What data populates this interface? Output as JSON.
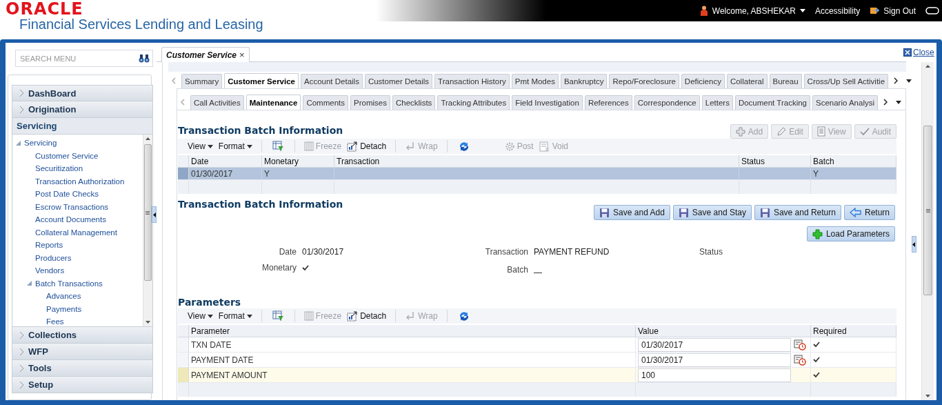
{
  "header": {
    "logo": "ORACLE",
    "product": "Financial Services Lending and Leasing",
    "user_menu": "Welcome, ABSHEKAR",
    "accessibility": "Accessibility",
    "sign_out": "Sign Out"
  },
  "sidebar": {
    "search": {
      "placeholder": "SEARCH MENU"
    },
    "sections": [
      {
        "label": "DashBoard",
        "expanded": false
      },
      {
        "label": "Origination",
        "expanded": false
      },
      {
        "label": "Servicing",
        "expanded": true,
        "tree": [
          {
            "label": "Servicing",
            "expanded": true,
            "children": [
              {
                "label": "Customer Service"
              },
              {
                "label": "Securitization"
              },
              {
                "label": "Transaction Authorization"
              },
              {
                "label": "Post Date Checks"
              },
              {
                "label": "Escrow Transactions"
              },
              {
                "label": "Account Documents"
              },
              {
                "label": "Collateral Management"
              },
              {
                "label": "Reports"
              },
              {
                "label": "Producers"
              },
              {
                "label": "Vendors"
              },
              {
                "label": "Batch Transactions",
                "expanded": true,
                "children": [
                  {
                    "label": "Advances"
                  },
                  {
                    "label": "Payments"
                  },
                  {
                    "label": "Fees"
                  }
                ]
              }
            ]
          }
        ]
      },
      {
        "label": "Collections",
        "expanded": false
      },
      {
        "label": "WFP",
        "expanded": false
      },
      {
        "label": "Tools",
        "expanded": false
      },
      {
        "label": "Setup",
        "expanded": false
      }
    ]
  },
  "document_tab": {
    "label": "Customer Service",
    "close": "×"
  },
  "close_link": "Close",
  "tabs": [
    {
      "label": "Summary",
      "selected": false
    },
    {
      "label": "Customer Service",
      "selected": true
    },
    {
      "label": "Account Details",
      "selected": false
    },
    {
      "label": "Customer Details",
      "selected": false
    },
    {
      "label": "Transaction History",
      "selected": false
    },
    {
      "label": "Pmt Modes",
      "selected": false
    },
    {
      "label": "Bankruptcy",
      "selected": false
    },
    {
      "label": "Repo/Foreclosure",
      "selected": false
    },
    {
      "label": "Deficiency",
      "selected": false
    },
    {
      "label": "Collateral",
      "selected": false
    },
    {
      "label": "Bureau",
      "selected": false
    },
    {
      "label": "Cross/Up Sell Activitie",
      "selected": false
    }
  ],
  "subtabs": [
    {
      "label": "Call Activities",
      "selected": false
    },
    {
      "label": "Maintenance",
      "selected": true
    },
    {
      "label": "Comments",
      "selected": false
    },
    {
      "label": "Promises",
      "selected": false
    },
    {
      "label": "Checklists",
      "selected": false
    },
    {
      "label": "Tracking Attributes",
      "selected": false
    },
    {
      "label": "Field Investigation",
      "selected": false
    },
    {
      "label": "References",
      "selected": false
    },
    {
      "label": "Correspondence",
      "selected": false
    },
    {
      "label": "Letters",
      "selected": false
    },
    {
      "label": "Document Tracking",
      "selected": false
    },
    {
      "label": "Scenario Analysi",
      "selected": false
    }
  ],
  "batch_list": {
    "title": "Transaction Batch Information",
    "actions": [
      {
        "kind": "add",
        "label": "Add",
        "disabled": true
      },
      {
        "kind": "edit",
        "label": "Edit",
        "disabled": true
      },
      {
        "kind": "view",
        "label": "View",
        "disabled": true
      },
      {
        "kind": "audit",
        "label": "Audit",
        "disabled": true
      }
    ],
    "toolbar": [
      {
        "kind": "menu",
        "label": "View",
        "disabled": false
      },
      {
        "kind": "menu",
        "label": "Format",
        "disabled": false
      },
      {
        "kind": "filter"
      },
      {
        "kind": "freeze",
        "label": "Freeze",
        "disabled": true
      },
      {
        "kind": "detach",
        "label": "Detach",
        "disabled": false
      },
      {
        "kind": "wrap",
        "label": "Wrap",
        "disabled": true
      },
      {
        "kind": "refresh"
      },
      {
        "kind": "post",
        "label": "Post",
        "disabled": true
      },
      {
        "kind": "void",
        "label": "Void",
        "disabled": true
      }
    ],
    "columns": [
      "Date",
      "Monetary",
      "Transaction",
      "Status",
      "Batch"
    ],
    "rows": [
      {
        "selected": true,
        "cells": [
          "01/30/2017",
          "Y",
          "",
          "",
          "Y"
        ]
      }
    ]
  },
  "batch_detail": {
    "title": "Transaction Batch Information",
    "buttons": [
      {
        "kind": "save",
        "label": "Save and Add"
      },
      {
        "kind": "save",
        "label": "Save and Stay"
      },
      {
        "kind": "save",
        "label": "Save and Return"
      },
      {
        "kind": "back",
        "label": "Return"
      }
    ],
    "load_button": "Load Parameters",
    "date_label": "Date",
    "date": "01/30/2017",
    "monetary_label": "Monetary",
    "monetary": true,
    "transaction_label": "Transaction",
    "transaction": "PAYMENT REFUND",
    "batch_label": "Batch",
    "status_label": "Status"
  },
  "parameters": {
    "title": "Parameters",
    "toolbar": [
      {
        "kind": "menu",
        "label": "View",
        "disabled": false
      },
      {
        "kind": "menu",
        "label": "Format",
        "disabled": false
      },
      {
        "kind": "filter"
      },
      {
        "kind": "freeze",
        "label": "Freeze",
        "disabled": true
      },
      {
        "kind": "detach",
        "label": "Detach",
        "disabled": false
      },
      {
        "kind": "wrap",
        "label": "Wrap",
        "disabled": true
      },
      {
        "kind": "refresh"
      }
    ],
    "columns": [
      "Parameter",
      "Value",
      "Required"
    ],
    "rows": [
      {
        "name": "TXN DATE",
        "value": "01/30/2017",
        "kind": "date",
        "required": true,
        "selected": false
      },
      {
        "name": "PAYMENT DATE",
        "value": "01/30/2017",
        "kind": "date",
        "required": true,
        "selected": false
      },
      {
        "name": "PAYMENT AMOUNT",
        "value": "100",
        "kind": "number",
        "required": true,
        "selected": true
      }
    ]
  }
}
